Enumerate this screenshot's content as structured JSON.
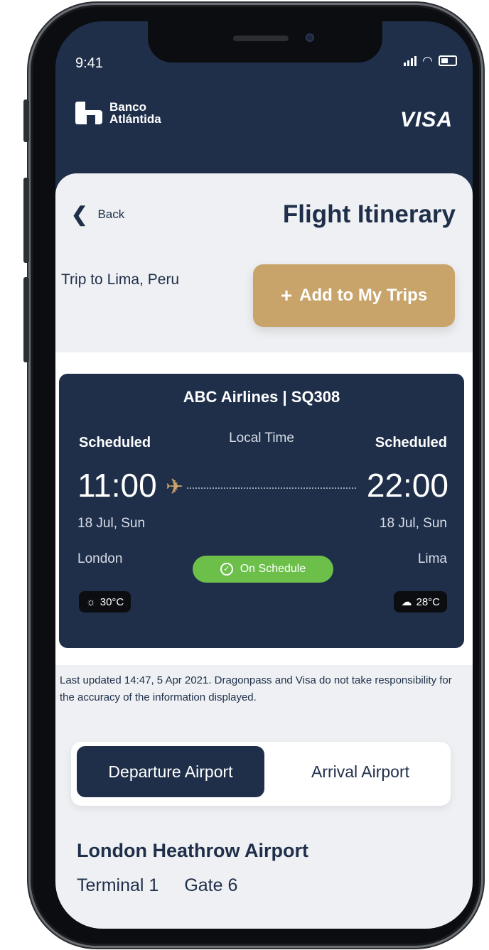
{
  "status_bar": {
    "time": "9:41"
  },
  "header": {
    "brand_name": "Banco Atlántida",
    "card_network": "VISA"
  },
  "nav": {
    "back_label": "Back",
    "page_title": "Flight Itinerary"
  },
  "trip": {
    "name": "Trip to Lima, Peru",
    "add_button_label": "Add to My Trips"
  },
  "flight": {
    "airline_and_number": "ABC Airlines | SQ308",
    "departure_status": "Scheduled",
    "arrival_status": "Scheduled",
    "time_note": "Local Time",
    "departure_time": "11:00",
    "arrival_time": "22:00",
    "departure_date": "18 Jul, Sun",
    "arrival_date": "18 Jul, Sun",
    "departure_city": "London",
    "arrival_city": "Lima",
    "status": "On Schedule",
    "status_color": "#6cc04a",
    "departure_weather": "30°C",
    "arrival_weather": "28°C",
    "departure_weather_icon": "sun-icon",
    "arrival_weather_icon": "cloud-icon"
  },
  "disclaimer": "Last updated 14:47, 5 Apr 2021. Dragonpass and Visa do not take responsibility for the accuracy of the information displayed.",
  "tabs": {
    "active": "Departure Airport",
    "inactive": "Arrival Airport"
  },
  "airport": {
    "name": "London Heathrow Airport",
    "terminal": "Terminal 1",
    "gate": "Gate 6"
  },
  "colors": {
    "navy": "#1f2f4a",
    "gold": "#c8a46a",
    "background": "#eef0f3"
  }
}
